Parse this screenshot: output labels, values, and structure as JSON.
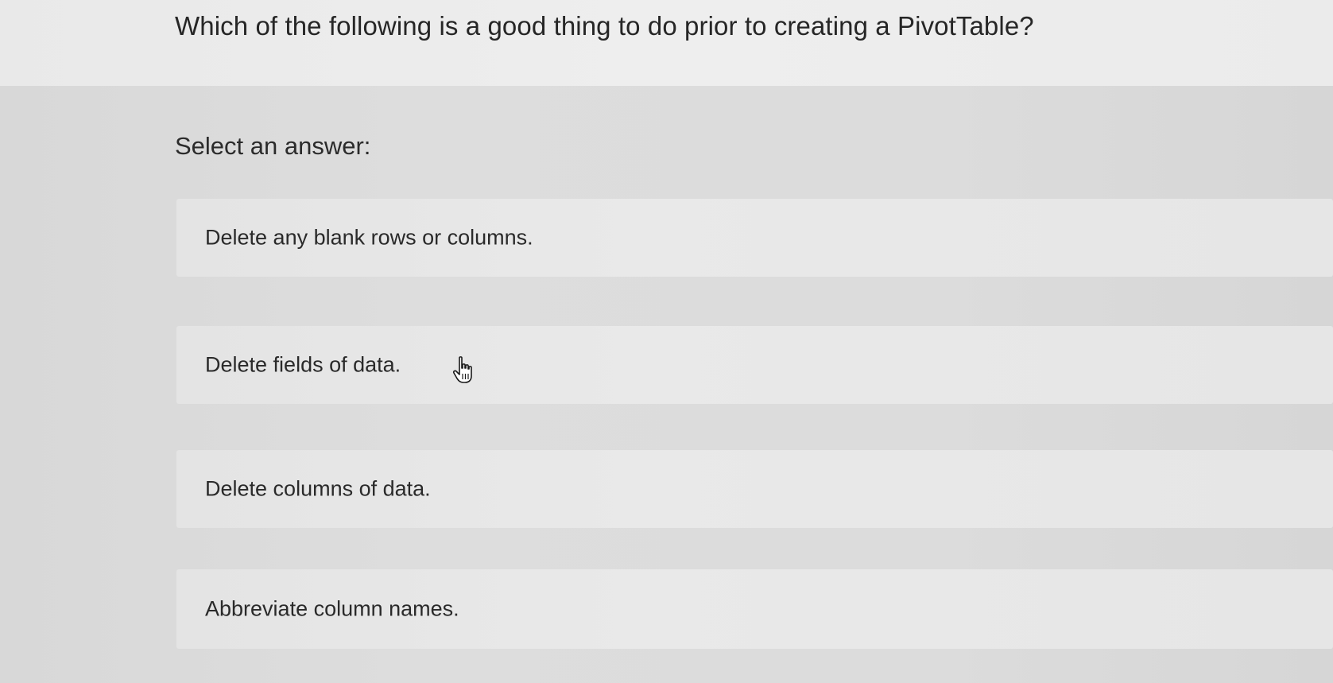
{
  "question": {
    "text": "Which of the following is a good thing to do prior to creating a PivotTable?"
  },
  "prompt": {
    "text": "Select an answer:"
  },
  "options": [
    {
      "label": "Delete any blank rows or columns."
    },
    {
      "label": "Delete fields of data."
    },
    {
      "label": "Delete columns of data."
    },
    {
      "label": "Abbreviate column names."
    }
  ],
  "cursor": {
    "icon": "hand-pointer-icon"
  },
  "colors": {
    "background": "#dcdcdc",
    "option_background": "#e8e8e8",
    "text": "#2a2a2a"
  }
}
